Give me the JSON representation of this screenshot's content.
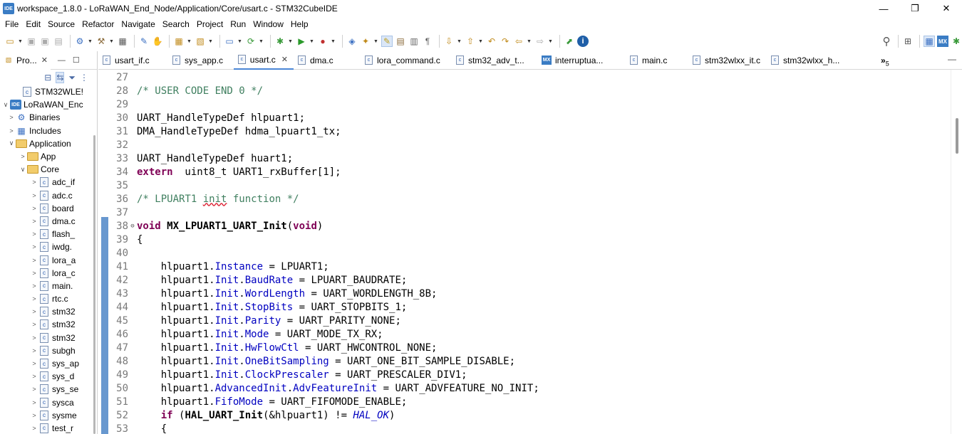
{
  "window": {
    "app_logo": "IDE",
    "title": "workspace_1.8.0 - LoRaWAN_End_Node/Application/Core/usart.c - STM32CubeIDE",
    "minimize": "—",
    "maximize": "❐",
    "close": "✕"
  },
  "menu": [
    "File",
    "Edit",
    "Source",
    "Refactor",
    "Navigate",
    "Search",
    "Project",
    "Run",
    "Window",
    "Help"
  ],
  "explorer": {
    "tab_label": "Pro...",
    "close": "✕",
    "minimize": "—",
    "maximize": "☐",
    "items": [
      {
        "arrow": "",
        "icon": "file",
        "label": "STM32WLE!"
      },
      {
        "arrow": "∨",
        "icon": "ide",
        "label": "LoRaWAN_Enc"
      },
      {
        "arrow": ">",
        "icon": "bin",
        "label": "Binaries"
      },
      {
        "arrow": ">",
        "icon": "inc",
        "label": "Includes"
      },
      {
        "arrow": "∨",
        "icon": "folder",
        "label": "Application"
      },
      {
        "arrow": ">",
        "icon": "folder",
        "label": "App"
      },
      {
        "arrow": "∨",
        "icon": "folder",
        "label": "Core"
      },
      {
        "arrow": ">",
        "icon": "file",
        "label": "adc_if"
      },
      {
        "arrow": ">",
        "icon": "file",
        "label": "adc.c"
      },
      {
        "arrow": ">",
        "icon": "file",
        "label": "board"
      },
      {
        "arrow": ">",
        "icon": "file",
        "label": "dma.c"
      },
      {
        "arrow": ">",
        "icon": "file",
        "label": "flash_"
      },
      {
        "arrow": ">",
        "icon": "file",
        "label": "iwdg."
      },
      {
        "arrow": ">",
        "icon": "file",
        "label": "lora_a"
      },
      {
        "arrow": ">",
        "icon": "file",
        "label": "lora_c"
      },
      {
        "arrow": ">",
        "icon": "file",
        "label": "main."
      },
      {
        "arrow": ">",
        "icon": "file",
        "label": "rtc.c"
      },
      {
        "arrow": ">",
        "icon": "file",
        "label": "stm32"
      },
      {
        "arrow": ">",
        "icon": "file",
        "label": "stm32"
      },
      {
        "arrow": ">",
        "icon": "file",
        "label": "stm32"
      },
      {
        "arrow": ">",
        "icon": "file",
        "label": "subgh"
      },
      {
        "arrow": ">",
        "icon": "file",
        "label": "sys_ap"
      },
      {
        "arrow": ">",
        "icon": "file",
        "label": "sys_d"
      },
      {
        "arrow": ">",
        "icon": "file",
        "label": "sys_se"
      },
      {
        "arrow": ">",
        "icon": "file",
        "label": "sysca"
      },
      {
        "arrow": ">",
        "icon": "file",
        "label": "sysme"
      },
      {
        "arrow": ">",
        "icon": "file",
        "label": "test_r"
      }
    ]
  },
  "editor": {
    "tabs": [
      {
        "label": "usart_if.c",
        "icon": "c",
        "active": false
      },
      {
        "label": "sys_app.c",
        "icon": "c",
        "active": false
      },
      {
        "label": "usart.c",
        "icon": "c",
        "active": true
      },
      {
        "label": "dma.c",
        "icon": "c",
        "active": false
      },
      {
        "label": "lora_command.c",
        "icon": "c",
        "active": false
      },
      {
        "label": "stm32_adv_t...",
        "icon": "c",
        "active": false
      },
      {
        "label": "interruptua...",
        "icon": "mx",
        "active": false
      },
      {
        "label": "main.c",
        "icon": "c",
        "active": false
      },
      {
        "label": "stm32wlxx_it.c",
        "icon": "c",
        "active": false
      },
      {
        "label": "stm32wlxx_h...",
        "icon": "c",
        "active": false
      }
    ],
    "overflow_count": "5",
    "lines": [
      {
        "n": "27",
        "fold": "",
        "segs": []
      },
      {
        "n": "28",
        "fold": "",
        "segs": [
          {
            "c": "cm",
            "t": "/* USER CODE END 0 */"
          }
        ]
      },
      {
        "n": "29",
        "fold": "",
        "segs": []
      },
      {
        "n": "30",
        "fold": "",
        "segs": [
          {
            "c": "",
            "t": "UART_HandleTypeDef hlpuart1;"
          }
        ]
      },
      {
        "n": "31",
        "fold": "",
        "segs": [
          {
            "c": "",
            "t": "DMA_HandleTypeDef hdma_lpuart1_tx;"
          }
        ]
      },
      {
        "n": "32",
        "fold": "",
        "segs": []
      },
      {
        "n": "33",
        "fold": "",
        "segs": [
          {
            "c": "",
            "t": "UART_HandleTypeDef huart1;"
          }
        ]
      },
      {
        "n": "34",
        "fold": "",
        "segs": [
          {
            "c": "kw",
            "t": "extern"
          },
          {
            "c": "",
            "t": "  uint8_t UART1_rxBuffer[1];"
          }
        ]
      },
      {
        "n": "35",
        "fold": "",
        "segs": []
      },
      {
        "n": "36",
        "fold": "",
        "segs": [
          {
            "c": "cm",
            "t": "/* LPUART1 "
          },
          {
            "c": "cm squig",
            "t": "init"
          },
          {
            "c": "cm",
            "t": " function */"
          }
        ]
      },
      {
        "n": "37",
        "fold": "",
        "segs": []
      },
      {
        "n": "38",
        "fold": "⊖",
        "segs": [
          {
            "c": "kw",
            "t": "void"
          },
          {
            "c": "",
            "t": " "
          },
          {
            "c": "fn",
            "t": "MX_LPUART1_UART_Init"
          },
          {
            "c": "",
            "t": "("
          },
          {
            "c": "kw",
            "t": "void"
          },
          {
            "c": "",
            "t": ")"
          }
        ]
      },
      {
        "n": "39",
        "fold": "",
        "segs": [
          {
            "c": "",
            "t": "{"
          }
        ]
      },
      {
        "n": "40",
        "fold": "",
        "segs": []
      },
      {
        "n": "41",
        "fold": "",
        "segs": [
          {
            "c": "",
            "t": "    hlpuart1."
          },
          {
            "c": "fld",
            "t": "Instance"
          },
          {
            "c": "",
            "t": " = LPUART1;"
          }
        ]
      },
      {
        "n": "42",
        "fold": "",
        "segs": [
          {
            "c": "",
            "t": "    hlpuart1."
          },
          {
            "c": "fld",
            "t": "Init"
          },
          {
            "c": "",
            "t": "."
          },
          {
            "c": "fld",
            "t": "BaudRate"
          },
          {
            "c": "",
            "t": " = LPUART_BAUDRATE;"
          }
        ]
      },
      {
        "n": "43",
        "fold": "",
        "segs": [
          {
            "c": "",
            "t": "    hlpuart1."
          },
          {
            "c": "fld",
            "t": "Init"
          },
          {
            "c": "",
            "t": "."
          },
          {
            "c": "fld",
            "t": "WordLength"
          },
          {
            "c": "",
            "t": " = UART_WORDLENGTH_8B;"
          }
        ]
      },
      {
        "n": "44",
        "fold": "",
        "segs": [
          {
            "c": "",
            "t": "    hlpuart1."
          },
          {
            "c": "fld",
            "t": "Init"
          },
          {
            "c": "",
            "t": "."
          },
          {
            "c": "fld",
            "t": "StopBits"
          },
          {
            "c": "",
            "t": " = UART_STOPBITS_1;"
          }
        ]
      },
      {
        "n": "45",
        "fold": "",
        "segs": [
          {
            "c": "",
            "t": "    hlpuart1."
          },
          {
            "c": "fld",
            "t": "Init"
          },
          {
            "c": "",
            "t": "."
          },
          {
            "c": "fld",
            "t": "Parity"
          },
          {
            "c": "",
            "t": " = UART_PARITY_NONE;"
          }
        ]
      },
      {
        "n": "46",
        "fold": "",
        "segs": [
          {
            "c": "",
            "t": "    hlpuart1."
          },
          {
            "c": "fld",
            "t": "Init"
          },
          {
            "c": "",
            "t": "."
          },
          {
            "c": "fld",
            "t": "Mode"
          },
          {
            "c": "",
            "t": " = UART_MODE_TX_RX;"
          }
        ]
      },
      {
        "n": "47",
        "fold": "",
        "segs": [
          {
            "c": "",
            "t": "    hlpuart1."
          },
          {
            "c": "fld",
            "t": "Init"
          },
          {
            "c": "",
            "t": "."
          },
          {
            "c": "fld",
            "t": "HwFlowCtl"
          },
          {
            "c": "",
            "t": " = UART_HWCONTROL_NONE;"
          }
        ]
      },
      {
        "n": "48",
        "fold": "",
        "segs": [
          {
            "c": "",
            "t": "    hlpuart1."
          },
          {
            "c": "fld",
            "t": "Init"
          },
          {
            "c": "",
            "t": "."
          },
          {
            "c": "fld",
            "t": "OneBitSampling"
          },
          {
            "c": "",
            "t": " = UART_ONE_BIT_SAMPLE_DISABLE;"
          }
        ]
      },
      {
        "n": "49",
        "fold": "",
        "segs": [
          {
            "c": "",
            "t": "    hlpuart1."
          },
          {
            "c": "fld",
            "t": "Init"
          },
          {
            "c": "",
            "t": "."
          },
          {
            "c": "fld",
            "t": "ClockPrescaler"
          },
          {
            "c": "",
            "t": " = UART_PRESCALER_DIV1;"
          }
        ]
      },
      {
        "n": "50",
        "fold": "",
        "segs": [
          {
            "c": "",
            "t": "    hlpuart1."
          },
          {
            "c": "fld",
            "t": "AdvancedInit"
          },
          {
            "c": "",
            "t": "."
          },
          {
            "c": "fld",
            "t": "AdvFeatureInit"
          },
          {
            "c": "",
            "t": " = UART_ADVFEATURE_NO_INIT;"
          }
        ]
      },
      {
        "n": "51",
        "fold": "",
        "segs": [
          {
            "c": "",
            "t": "    hlpuart1."
          },
          {
            "c": "fld",
            "t": "FifoMode"
          },
          {
            "c": "",
            "t": " = UART_FIFOMODE_ENABLE;"
          }
        ]
      },
      {
        "n": "52",
        "fold": "",
        "segs": [
          {
            "c": "",
            "t": "    "
          },
          {
            "c": "kw",
            "t": "if"
          },
          {
            "c": "",
            "t": " ("
          },
          {
            "c": "fn",
            "t": "HAL_UART_Init"
          },
          {
            "c": "",
            "t": "(&hlpuart1) != "
          },
          {
            "c": "it",
            "t": "HAL_OK"
          },
          {
            "c": "",
            "t": ")"
          }
        ]
      },
      {
        "n": "53",
        "fold": "",
        "segs": [
          {
            "c": "",
            "t": "    {"
          }
        ]
      }
    ]
  },
  "colors": {
    "comment": "#3f7f5f",
    "keyword": "#7f0055",
    "field": "#0000c0",
    "change_bar": "#4d86c7",
    "active_tab_accent": "#4a86d6"
  }
}
